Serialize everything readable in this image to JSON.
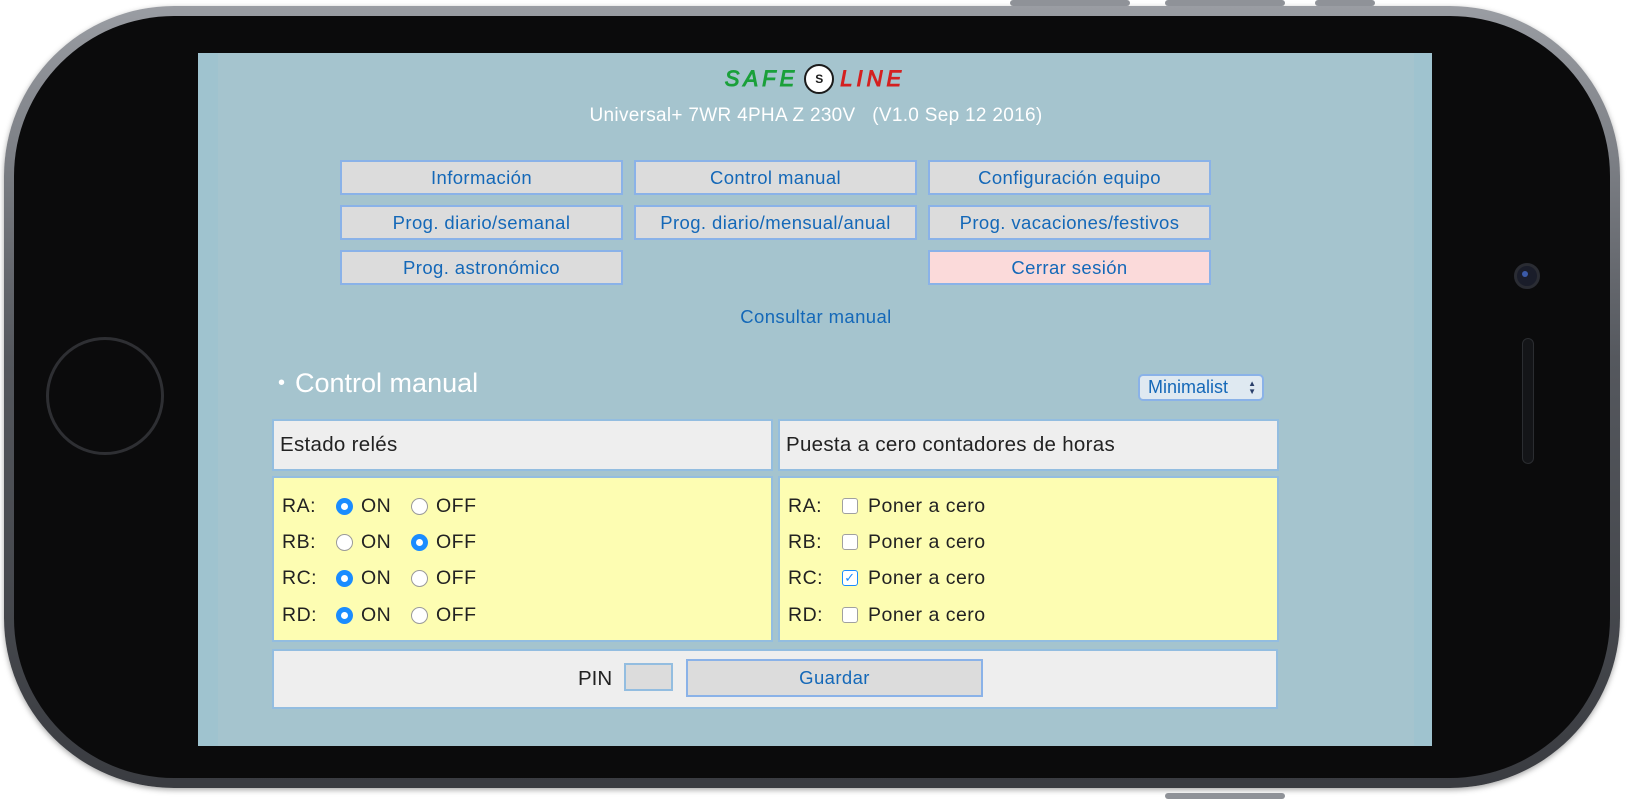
{
  "device": {
    "logo_left": "SAFE",
    "logo_mark": "S",
    "logo_right": "LINE",
    "title": "Universal+ 7WR 4PHA Z 230V   (V1.0 Sep 12 2016)"
  },
  "nav": {
    "informacion": "Información",
    "control_manual": "Control manual",
    "configuracion": "Configuración equipo",
    "prog_semanal": "Prog. diario/semanal",
    "prog_anual": "Prog. diario/mensual/anual",
    "prog_vacaciones": "Prog. vacaciones/festivos",
    "prog_astronomico": "Prog. astronómico",
    "cerrar_sesion": "Cerrar sesión"
  },
  "manual_link": "Consultar manual",
  "section": {
    "title": "Control manual",
    "theme_select": "Minimalist"
  },
  "relays": {
    "header": "Estado relés",
    "on_label": "ON",
    "off_label": "OFF",
    "rows": [
      {
        "label": "RA:",
        "state": "ON"
      },
      {
        "label": "RB:",
        "state": "OFF"
      },
      {
        "label": "RC:",
        "state": "ON"
      },
      {
        "label": "RD:",
        "state": "ON"
      }
    ]
  },
  "reset": {
    "header": "Puesta a cero contadores de horas",
    "rows": [
      {
        "label": "RA:",
        "text": "Poner a cero",
        "checked": false
      },
      {
        "label": "RB:",
        "text": "Poner a cero",
        "checked": false
      },
      {
        "label": "RC:",
        "text": "Poner a cero",
        "checked": true
      },
      {
        "label": "RD:",
        "text": "Poner a cero",
        "checked": false
      }
    ]
  },
  "footer": {
    "pin_label": "PIN",
    "pin_value": "",
    "save_label": "Guardar"
  },
  "colors": {
    "accent": "#1468b8",
    "panel": "#a5c4ce",
    "body_box": "#fdfdb2",
    "logout": "#fbdada"
  }
}
